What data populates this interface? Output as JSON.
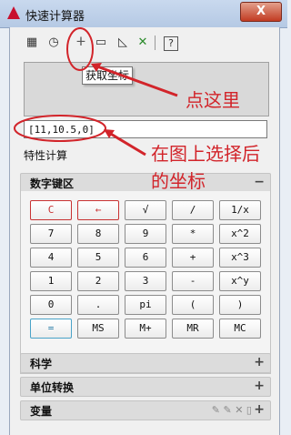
{
  "window": {
    "title": "快速计算器",
    "close_label": "X"
  },
  "toolbar": {
    "tooltip": "获取坐标",
    "icons": [
      "clear-icon",
      "clear-history-icon",
      "get-coordinates-icon",
      "distance-icon",
      "angle-icon",
      "intersection-icon",
      "help-icon"
    ]
  },
  "input": {
    "value": "[11,10.5,0]"
  },
  "feature_label": "特性计算",
  "panels": {
    "numpad": "数字键区",
    "sci": "科学",
    "units": "单位转换",
    "vars": "变量"
  },
  "keys": [
    [
      "C",
      "←",
      "√",
      "/",
      "1/x"
    ],
    [
      "7",
      "8",
      "9",
      "*",
      "x^2"
    ],
    [
      "4",
      "5",
      "6",
      "+",
      "x^3"
    ],
    [
      "1",
      "2",
      "3",
      "-",
      "x^y"
    ],
    [
      "0",
      ".",
      "pi",
      "(",
      ")"
    ],
    [
      "=",
      "MS",
      "M+",
      "MR",
      "MC"
    ]
  ],
  "annotations": {
    "click_here": "点这里",
    "select_line1": "在图上选择后",
    "select_line2": "的坐标"
  },
  "colors": {
    "annotation": "#d2242a",
    "accent_blue": "#4aa3c8"
  }
}
